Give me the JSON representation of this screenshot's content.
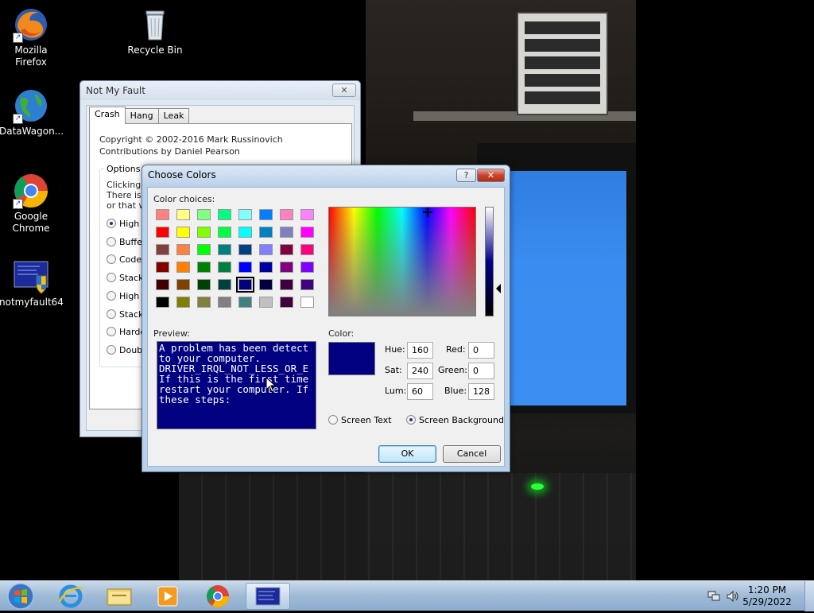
{
  "desktop": {
    "icons": [
      {
        "label_1": "Mozilla",
        "label_2": "Firefox",
        "icon": "firefox-icon"
      },
      {
        "label_1": "Recycle Bin",
        "icon": "recycle-bin-icon"
      },
      {
        "label_1": "DataWagon...",
        "icon": "datawagon-icon"
      },
      {
        "label_1": "Google",
        "label_2": "Chrome",
        "icon": "chrome-icon"
      },
      {
        "label_1": "notmyfault64",
        "icon": "notmyfault-icon"
      }
    ]
  },
  "notmyfault": {
    "title": "Not My Fault",
    "tabs": [
      "Crash",
      "Hang",
      "Leak"
    ],
    "active_tab": "Crash",
    "copyright": "Copyright © 2002-2016 Mark Russinovich",
    "contributions": "Contributions by Daniel Pearson",
    "options_label": "Options",
    "options_desc": [
      "Clicking th",
      "There is a",
      "or that wo"
    ],
    "radios": [
      {
        "label": "High Ir",
        "checked": true
      },
      {
        "label": "Buffer",
        "checked": false
      },
      {
        "label": "Code c",
        "checked": false
      },
      {
        "label": "Stack",
        "checked": false
      },
      {
        "label": "High Ir",
        "checked": false
      },
      {
        "label": "Stack",
        "checked": false
      },
      {
        "label": "Hardc",
        "checked": false
      },
      {
        "label": "Double",
        "checked": false
      }
    ]
  },
  "choose_colors": {
    "title": "Choose Colors",
    "help_label": "?",
    "close_label": "✕",
    "color_choices_label": "Color choices:",
    "swatches": [
      [
        "#ff8080",
        "#ffff80",
        "#80ff80",
        "#00ff80",
        "#80ffff",
        "#0080ff",
        "#ff80c0",
        "#ff80ff"
      ],
      [
        "#ff0000",
        "#ffff00",
        "#80ff00",
        "#00ff40",
        "#00ffff",
        "#0080c0",
        "#8080c0",
        "#ff00ff"
      ],
      [
        "#804040",
        "#ff8040",
        "#00ff00",
        "#008080",
        "#004080",
        "#8080ff",
        "#800040",
        "#ff0080"
      ],
      [
        "#800000",
        "#ff8000",
        "#008000",
        "#008040",
        "#0000ff",
        "#0000a0",
        "#800080",
        "#8000ff"
      ],
      [
        "#400000",
        "#804000",
        "#004000",
        "#004040",
        "#000080",
        "#000040",
        "#400040",
        "#400080"
      ],
      [
        "#000000",
        "#808000",
        "#808040",
        "#808080",
        "#408080",
        "#c0c0c0",
        "#400040",
        "#ffffff"
      ]
    ],
    "selected_swatch": "#000080",
    "preview_label": "Preview:",
    "preview_lines": [
      "A problem has been detect",
      "to your computer.",
      "",
      "DRIVER_IRQL_NOT_LESS_OR_E",
      "",
      "If this is the first time",
      "restart your computer. If",
      "these steps:"
    ],
    "color_label": "Color:",
    "current_color": "#000080",
    "hue_label": "Hue:",
    "hue": "160",
    "sat_label": "Sat:",
    "sat": "240",
    "lum_label": "Lum:",
    "lum": "60",
    "red_label": "Red:",
    "red": "0",
    "green_label": "Green:",
    "green": "0",
    "blue_label": "Blue:",
    "blue": "128",
    "radio_screen_text": "Screen Text",
    "radio_screen_background": "Screen Background",
    "selected_target": "Screen Background",
    "ok_label": "OK",
    "cancel_label": "Cancel"
  },
  "taskbar": {
    "time": "1:20 PM",
    "date": "5/29/2022",
    "pinned": [
      "internet-explorer-icon",
      "file-explorer-icon",
      "media-player-icon",
      "chrome-icon",
      "notmyfault-icon"
    ]
  }
}
